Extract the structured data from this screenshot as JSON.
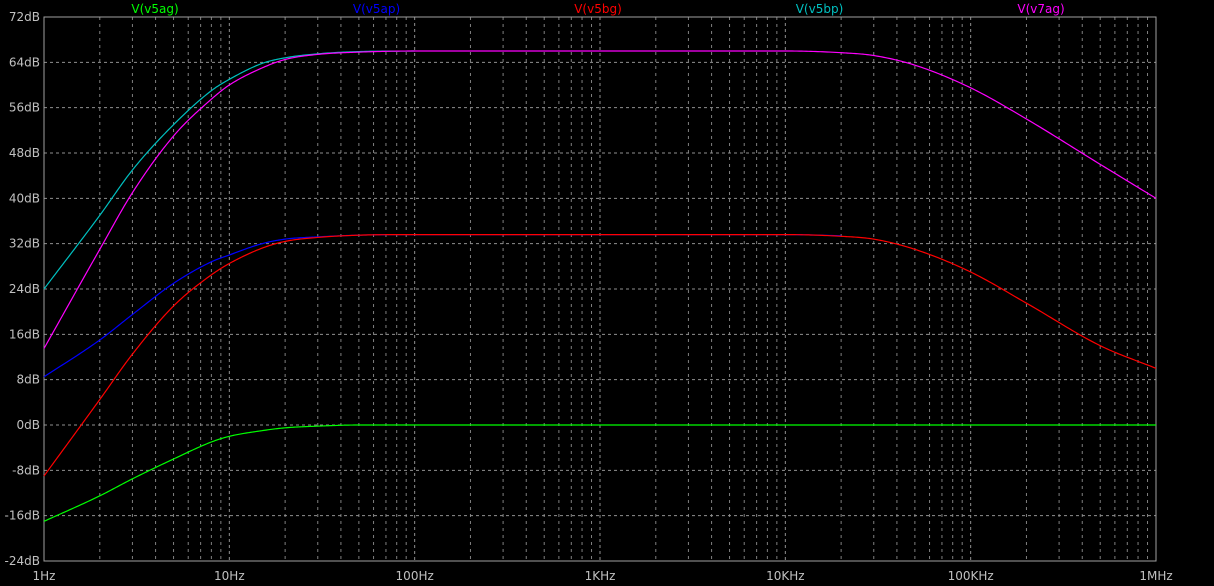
{
  "chart_data": {
    "type": "line",
    "title": "",
    "xlabel": "",
    "ylabel": "",
    "x_scale": "log",
    "xlim": [
      1,
      1000000
    ],
    "ylim": [
      -24,
      72
    ],
    "grid": true,
    "x_ticks": [
      {
        "value": 1,
        "label": "1Hz"
      },
      {
        "value": 10,
        "label": "10Hz"
      },
      {
        "value": 100,
        "label": "100Hz"
      },
      {
        "value": 1000,
        "label": "1KHz"
      },
      {
        "value": 10000,
        "label": "10KHz"
      },
      {
        "value": 100000,
        "label": "100KHz"
      },
      {
        "value": 1000000,
        "label": "1MHz"
      }
    ],
    "y_ticks": [
      {
        "value": 72,
        "label": "72dB"
      },
      {
        "value": 64,
        "label": "64dB"
      },
      {
        "value": 56,
        "label": "56dB"
      },
      {
        "value": 48,
        "label": "48dB"
      },
      {
        "value": 40,
        "label": "40dB"
      },
      {
        "value": 32,
        "label": "32dB"
      },
      {
        "value": 24,
        "label": "24dB"
      },
      {
        "value": 16,
        "label": "16dB"
      },
      {
        "value": 8,
        "label": "8dB"
      },
      {
        "value": 0,
        "label": "0dB"
      },
      {
        "value": -8,
        "label": "-8dB"
      },
      {
        "value": -16,
        "label": "-16dB"
      },
      {
        "value": -24,
        "label": "-24dB"
      }
    ],
    "legend_position": "top",
    "series": [
      {
        "name": "V(v5ag)",
        "color": "#00ff00",
        "x": [
          1,
          2,
          3,
          5,
          8,
          10,
          15,
          20,
          30,
          50,
          100,
          1000,
          10000,
          100000,
          1000000
        ],
        "y": [
          -17,
          -12.5,
          -9.5,
          -6,
          -3,
          -2,
          -1,
          -0.5,
          -0.2,
          0,
          0,
          0,
          0,
          0,
          0
        ]
      },
      {
        "name": "V(v5ap)",
        "color": "#0000ff",
        "x": [
          1,
          2,
          3,
          5,
          8,
          10,
          15,
          20,
          30,
          50,
          100,
          1000,
          10000,
          20000
        ],
        "y": [
          8.5,
          15,
          19.5,
          25,
          28.8,
          30,
          32,
          32.8,
          33.2,
          33.5,
          33.6,
          33.6,
          33.6,
          33.4
        ]
      },
      {
        "name": "V(v5bg)",
        "color": "#ff0000",
        "x": [
          1,
          2,
          3,
          5,
          8,
          10,
          15,
          20,
          30,
          50,
          100,
          1000,
          10000,
          20000,
          30000,
          50000,
          100000,
          200000,
          500000,
          1000000
        ],
        "y": [
          -9,
          4.5,
          12.5,
          21,
          26.5,
          28.5,
          31.2,
          32.4,
          33.1,
          33.5,
          33.6,
          33.6,
          33.6,
          33.3,
          32.8,
          31,
          27,
          21.5,
          14,
          10
        ]
      },
      {
        "name": "V(v5bp)",
        "color": "#00c0c0",
        "x": [
          1,
          2,
          3,
          5,
          8,
          10,
          15,
          20,
          30,
          50,
          100
        ],
        "y": [
          24,
          37,
          45,
          53,
          59,
          61,
          63.8,
          64.8,
          65.5,
          65.9,
          66
        ]
      },
      {
        "name": "V(v7ag)",
        "color": "#ff00ff",
        "x": [
          1,
          2,
          3,
          5,
          8,
          10,
          15,
          20,
          30,
          50,
          100,
          1000,
          10000,
          20000,
          30000,
          50000,
          100000,
          200000,
          500000,
          1000000
        ],
        "y": [
          13.5,
          31,
          41,
          51,
          57.5,
          60,
          63,
          64.5,
          65.4,
          65.8,
          66,
          66,
          66,
          65.7,
          65.2,
          63.5,
          59.5,
          54,
          46,
          40
        ]
      }
    ]
  }
}
